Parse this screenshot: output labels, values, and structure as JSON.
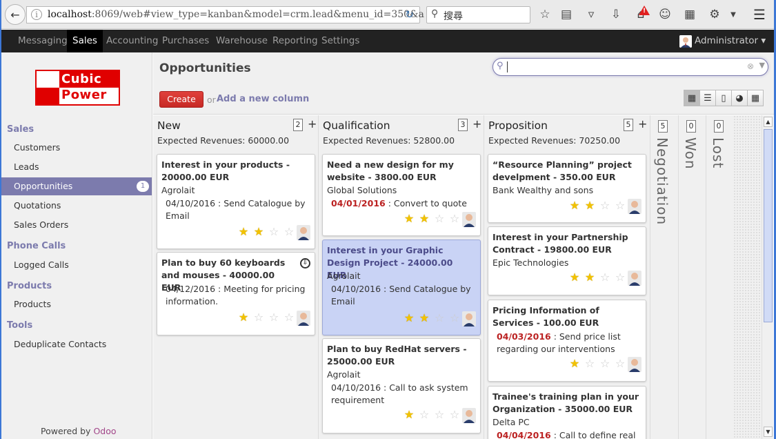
{
  "browser": {
    "url_host": "localhost",
    "url_path": ":8069/web#view_type=kanban&model=crm.lead&menu_id=350&a",
    "search_placeholder": "搜尋"
  },
  "topnav": {
    "items": [
      "Messaging",
      "Sales",
      "Accounting",
      "Purchases",
      "Warehouse",
      "Reporting",
      "Settings"
    ],
    "active": "Sales",
    "user": "Administrator"
  },
  "sidebar": {
    "logo_line1": "Cubic",
    "logo_line2": "Power",
    "sections": [
      {
        "title": "Sales",
        "items": [
          "Customers",
          "Leads",
          "Opportunities",
          "Quotations",
          "Sales Orders"
        ]
      },
      {
        "title": "Phone Calls",
        "items": [
          "Logged Calls"
        ]
      },
      {
        "title": "Products",
        "items": [
          "Products"
        ]
      },
      {
        "title": "Tools",
        "items": [
          "Deduplicate Contacts"
        ]
      }
    ],
    "active_item": "Opportunities",
    "active_badge": "1",
    "powered_by": "Powered by",
    "powered_brand": "Odoo"
  },
  "main": {
    "title": "Opportunities",
    "create_label": "Create",
    "or_text": "or",
    "add_column_label": "Add a new column"
  },
  "columns": [
    {
      "title": "New",
      "count": "2",
      "revenue": "Expected Revenues: 60000.00",
      "cards": [
        {
          "title": "Interest in your products - 20000.00 EUR",
          "company": "Agrolait",
          "date": "04/10/2016",
          "late": false,
          "activity": " : Send Catalogue by Email",
          "stars": 2,
          "selected": false
        },
        {
          "title": "Plan to buy 60 keyboards and mouses - 40000.00 EUR",
          "company": "",
          "date": "04/12/2016",
          "late": false,
          "activity": " : Meeting for pricing information.",
          "stars": 1,
          "selected": false
        }
      ]
    },
    {
      "title": "Qualification",
      "count": "3",
      "revenue": "Expected Revenues: 52800.00",
      "cards": [
        {
          "title": "Need a new design for my website - 3800.00 EUR",
          "company": "Global Solutions",
          "date": "04/01/2016",
          "late": true,
          "activity": " : Convert to quote",
          "stars": 2,
          "selected": false
        },
        {
          "title": "Interest in your Graphic Design Project - 24000.00 EUR",
          "company": "Agrolait",
          "date": "04/10/2016",
          "late": false,
          "activity": " : Send Catalogue by Email",
          "stars": 2,
          "selected": true
        },
        {
          "title": "Plan to buy RedHat servers - 25000.00 EUR",
          "company": "Agrolait",
          "date": "04/10/2016",
          "late": false,
          "activity": " : Call to ask system requirement",
          "stars": 1,
          "selected": false
        }
      ]
    },
    {
      "title": "Proposition",
      "count": "5",
      "revenue": "Expected Revenues: 70250.00",
      "cards": [
        {
          "title": "“Resource Planning” project develpment - 350.00 EUR",
          "company": "Bank Wealthy and sons",
          "date": "",
          "late": false,
          "activity": "",
          "stars": 2,
          "selected": false
        },
        {
          "title": "Interest in your Partnership Contract - 19800.00 EUR",
          "company": "Epic Technologies",
          "date": "",
          "late": false,
          "activity": "",
          "stars": 2,
          "selected": false
        },
        {
          "title": "Pricing Information of Services - 100.00 EUR",
          "company": "",
          "date": "04/03/2016",
          "late": true,
          "activity": " : Send price list regarding our interventions",
          "stars": 1,
          "selected": false
        },
        {
          "title": "Trainee's training plan in your Organization - 35000.00 EUR",
          "company": "Delta PC",
          "date": "04/04/2016",
          "late": true,
          "activity": " : Call to define real",
          "stars": 0,
          "selected": false
        }
      ]
    }
  ],
  "folded_columns": [
    {
      "title": "Negotiation",
      "count": "5"
    },
    {
      "title": "Won",
      "count": "0"
    },
    {
      "title": "Lost",
      "count": "0"
    }
  ],
  "colors": {
    "accent": "#7c7bad",
    "create": "#d9302c",
    "late_date": "#b22222",
    "selected_card": "#c9d3f5"
  }
}
